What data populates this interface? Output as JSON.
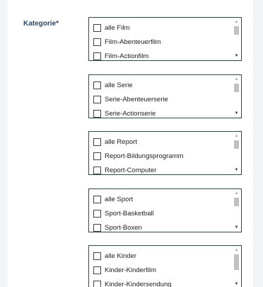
{
  "form": {
    "label": "Kategorie*"
  },
  "groups": [
    {
      "options": [
        {
          "label": "alle Film",
          "checked": false
        },
        {
          "label": "Film-Abenteuerfilm",
          "checked": false
        },
        {
          "label": "Film-Actionfilm",
          "checked": false
        }
      ]
    },
    {
      "options": [
        {
          "label": "alle Serie",
          "checked": false
        },
        {
          "label": "Serie-Abenteuerserie",
          "checked": false
        },
        {
          "label": "Serie-Actionserie",
          "checked": false
        }
      ]
    },
    {
      "options": [
        {
          "label": "alle Report",
          "checked": false
        },
        {
          "label": "Report-Bildungsprogramm",
          "checked": false
        },
        {
          "label": "Report-Computer",
          "checked": false
        }
      ]
    },
    {
      "options": [
        {
          "label": "alle Sport",
          "checked": false
        },
        {
          "label": "Sport-Basketball",
          "checked": false
        },
        {
          "label": "Sport-Boxen",
          "checked": false
        }
      ]
    },
    {
      "options": [
        {
          "label": "alle Kinder",
          "checked": false
        },
        {
          "label": "Kinder-Kinderfilm",
          "checked": false
        },
        {
          "label": "Kinder-Kindersendung",
          "checked": false
        }
      ]
    }
  ],
  "icons": {
    "scroll_up": "triangle-up-icon",
    "scroll_down": "triangle-down-icon"
  },
  "colors": {
    "label": "#2b4660",
    "box_border": "#2e4a4a",
    "background": "#f3f4f5"
  }
}
